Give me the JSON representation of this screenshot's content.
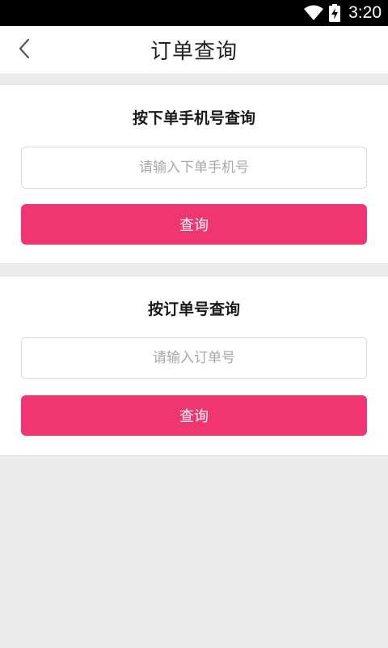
{
  "status_bar": {
    "time": "3:20",
    "icons": [
      "wifi-icon",
      "battery-charging-icon"
    ]
  },
  "header": {
    "title": "订单查询",
    "back_icon": "chevron-left-icon"
  },
  "phone_query": {
    "title": "按下单手机号查询",
    "input_placeholder": "请输入下单手机号",
    "input_value": "",
    "button_label": "查询"
  },
  "order_query": {
    "title": "按订单号查询",
    "input_placeholder": "请输入订单号",
    "input_value": "",
    "button_label": "查询"
  },
  "colors": {
    "accent": "#ef3670",
    "background": "#ececec",
    "card": "#ffffff",
    "status_bar": "#000000"
  }
}
